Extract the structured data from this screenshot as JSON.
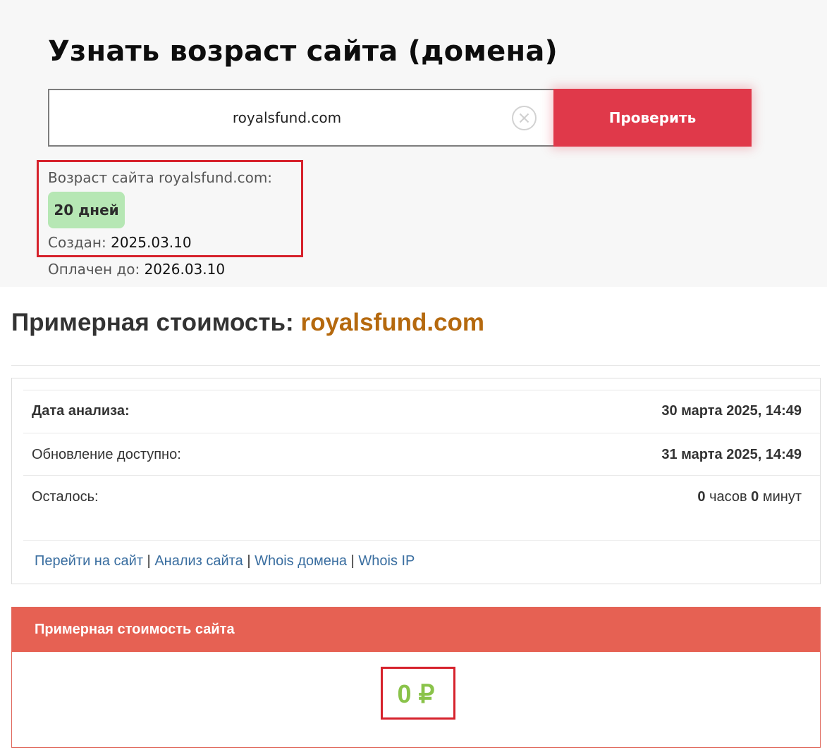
{
  "checker": {
    "title": "Узнать возраст сайта (домена)",
    "domain_value": "royalsfund.com",
    "check_label": "Проверить",
    "clear_icon": "close-circle-icon",
    "age_label": "Возраст сайта royalsfund.com:",
    "age_value": "20 дней",
    "created_label": "Создан:",
    "created_value": "2025.03.10",
    "paid_label": "Оплачен до:",
    "paid_value": "2026.03.10"
  },
  "cost": {
    "title_prefix": "Примерная стоимость:",
    "title_domain": "royalsfund.com",
    "rows": [
      {
        "label": "Дата анализа:",
        "value": "30 марта 2025, 14:49"
      },
      {
        "label": "Обновление доступно:",
        "value": "31 марта 2025, 14:49"
      }
    ],
    "remaining": {
      "label": "Осталось:",
      "hours": "0",
      "hours_unit": "часов",
      "minutes": "0",
      "minutes_unit": "минут"
    },
    "links": [
      "Перейти на сайт",
      "Анализ сайта",
      "Whois домена",
      "Whois IP"
    ],
    "link_separator": "|",
    "price_header": "Примерная стоимость сайта",
    "price_value": "0 ₽"
  },
  "colors": {
    "button": "#e0394a",
    "age_badge": "#b6e7b4",
    "highlight_frame": "#d6222c",
    "domain_title": "#b5690e",
    "price_header": "#e66153",
    "price_value": "#8ac34a",
    "link": "#3a6ea0"
  }
}
